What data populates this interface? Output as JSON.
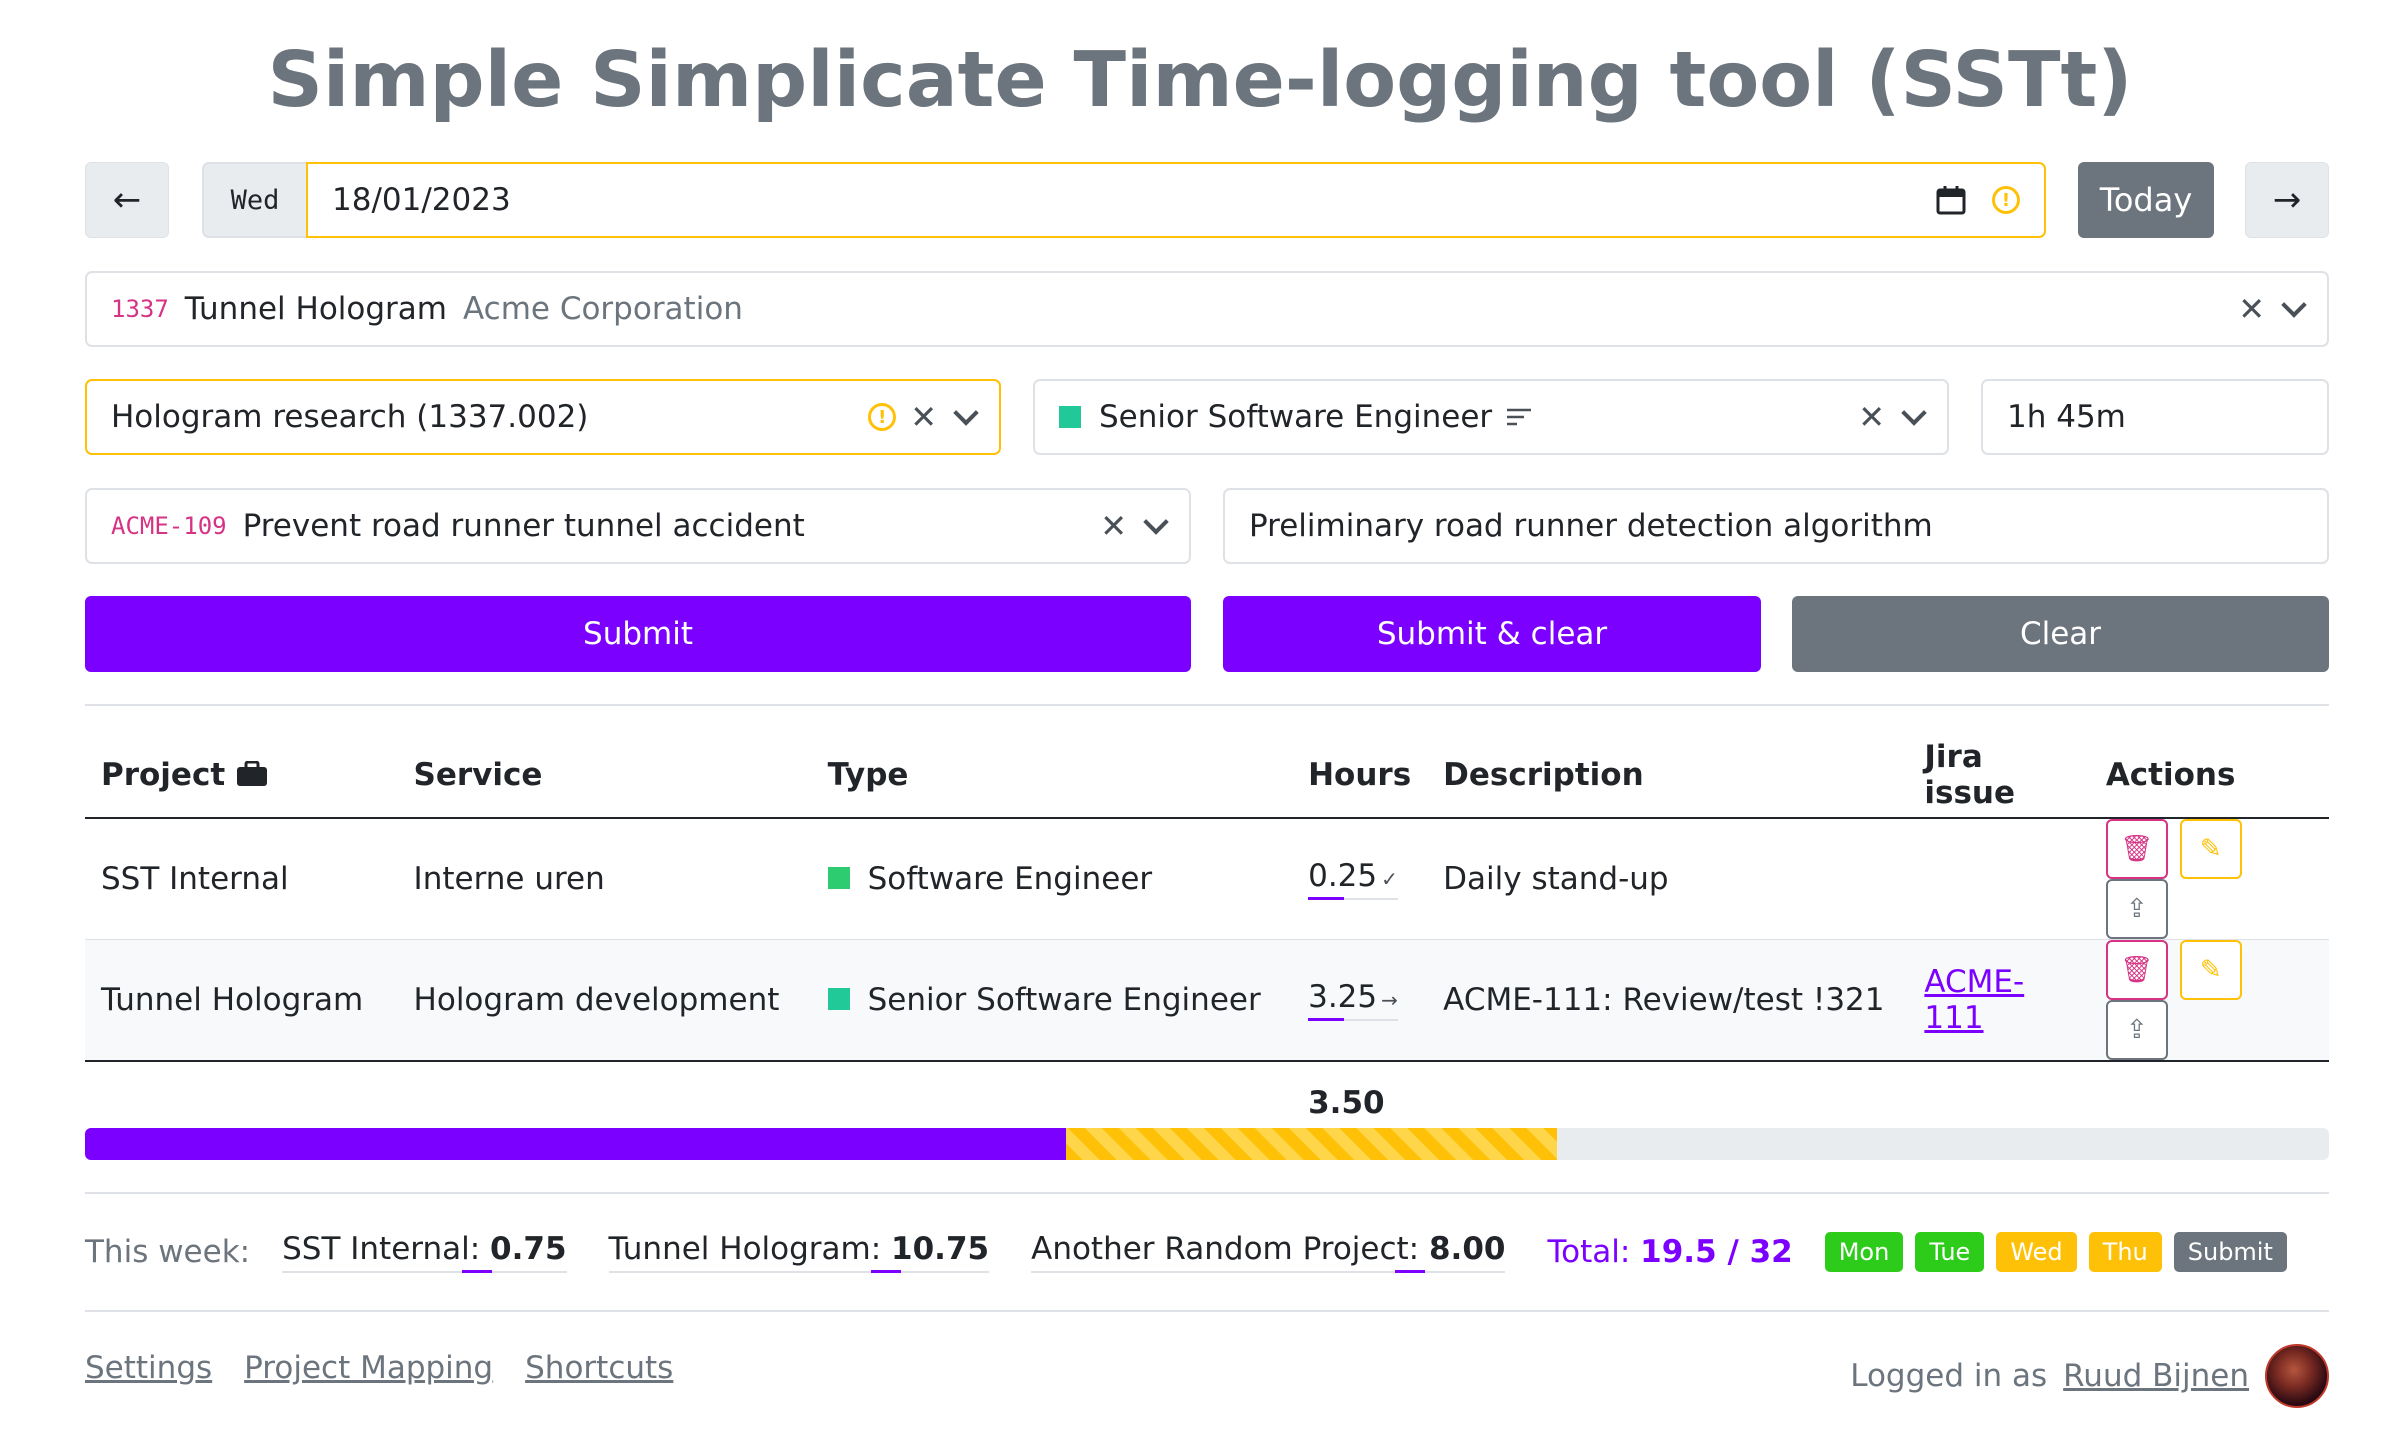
{
  "app": {
    "title": "Simple Simplicate Time-logging tool (SSTt)"
  },
  "date_nav": {
    "prev_label": "←",
    "day": "Wed",
    "date": "18/01/2023",
    "today_label": "Today",
    "next_label": "→"
  },
  "project_select": {
    "code": "1337",
    "name": "Tunnel Hologram",
    "client": "Acme Corporation"
  },
  "service_select": {
    "value": "Hologram research (1337.002)"
  },
  "type_select": {
    "value": "Senior Software Engineer",
    "color": "#20c997"
  },
  "duration_input": {
    "value": "1h 45m"
  },
  "jira_select": {
    "code": "ACME-109",
    "title": "Prevent road runner tunnel accident"
  },
  "description_input": {
    "value": "Preliminary road runner detection algorithm"
  },
  "buttons": {
    "submit": "Submit",
    "submit_clear": "Submit & clear",
    "clear": "Clear"
  },
  "table": {
    "headers": [
      "Project",
      "Service",
      "Type",
      "Hours",
      "Description",
      "Jira issue",
      "Actions"
    ],
    "rows": [
      {
        "project": "SST Internal",
        "service": "Interne uren",
        "type": "Software Engineer",
        "hours": "0.25",
        "hours_icon": "✓",
        "description": "Daily stand-up",
        "jira": ""
      },
      {
        "project": "Tunnel Hologram",
        "service": "Hologram development",
        "type": "Senior Software Engineer",
        "hours": "3.25",
        "hours_icon": "→",
        "description": "ACME-111: Review/test !321",
        "jira": "ACME-111"
      }
    ],
    "total_hours": "3.50"
  },
  "progress": {
    "logged_fraction": 0.437,
    "pending_fraction": 0.219,
    "colors": {
      "logged": "#7c00ff",
      "pending": "#ffc107"
    }
  },
  "week": {
    "label": "This week:",
    "projects": [
      {
        "name": "SST Internal:",
        "hours": "0.75"
      },
      {
        "name": "Tunnel Hologram:",
        "hours": "10.75"
      },
      {
        "name": "Another Random Project:",
        "hours": "8.00"
      }
    ],
    "total_label": "Total:",
    "total_value": "19.5 / 32",
    "days": [
      "Mon",
      "Tue",
      "Wed",
      "Thu"
    ],
    "submit_label": "Submit"
  },
  "footer": {
    "links": [
      "Settings",
      "Project Mapping",
      "Shortcuts"
    ],
    "logged_in_prefix": "Logged in as",
    "user": "Ruud Bijnen"
  }
}
